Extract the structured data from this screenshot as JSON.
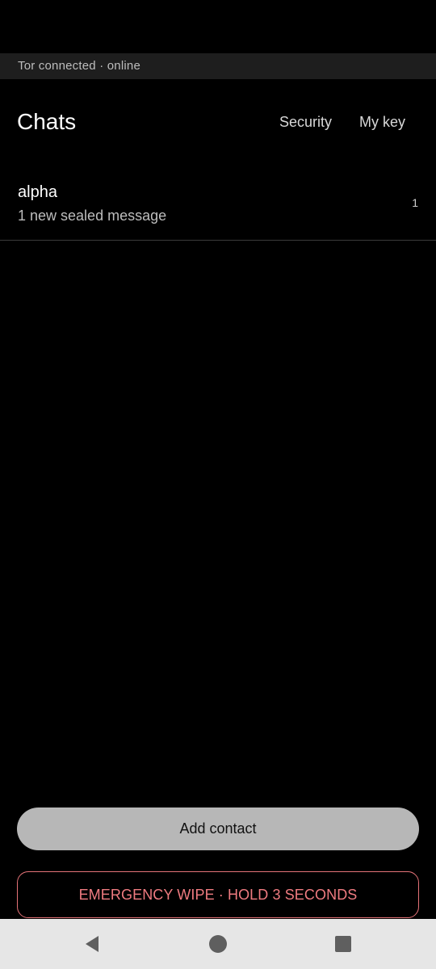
{
  "status": {
    "text": "Tor connected · online"
  },
  "header": {
    "title": "Chats",
    "actions": {
      "security": "Security",
      "my_key": "My key"
    }
  },
  "chats": [
    {
      "name": "alpha",
      "preview": "1 new sealed message",
      "count": "1"
    }
  ],
  "buttons": {
    "add_contact": "Add contact",
    "emergency_wipe": "EMERGENCY WIPE · HOLD 3 SECONDS"
  },
  "nav": {
    "icons": [
      "back-icon",
      "home-icon",
      "recents-icon"
    ]
  },
  "colors": {
    "background": "#000000",
    "status_strip": "#1e1e1e",
    "add_contact_bg": "#b7b7b7",
    "wipe_accent": "#ef7b80",
    "nav_bar": "#e6e6e6",
    "nav_icon": "#5f5f5f"
  }
}
